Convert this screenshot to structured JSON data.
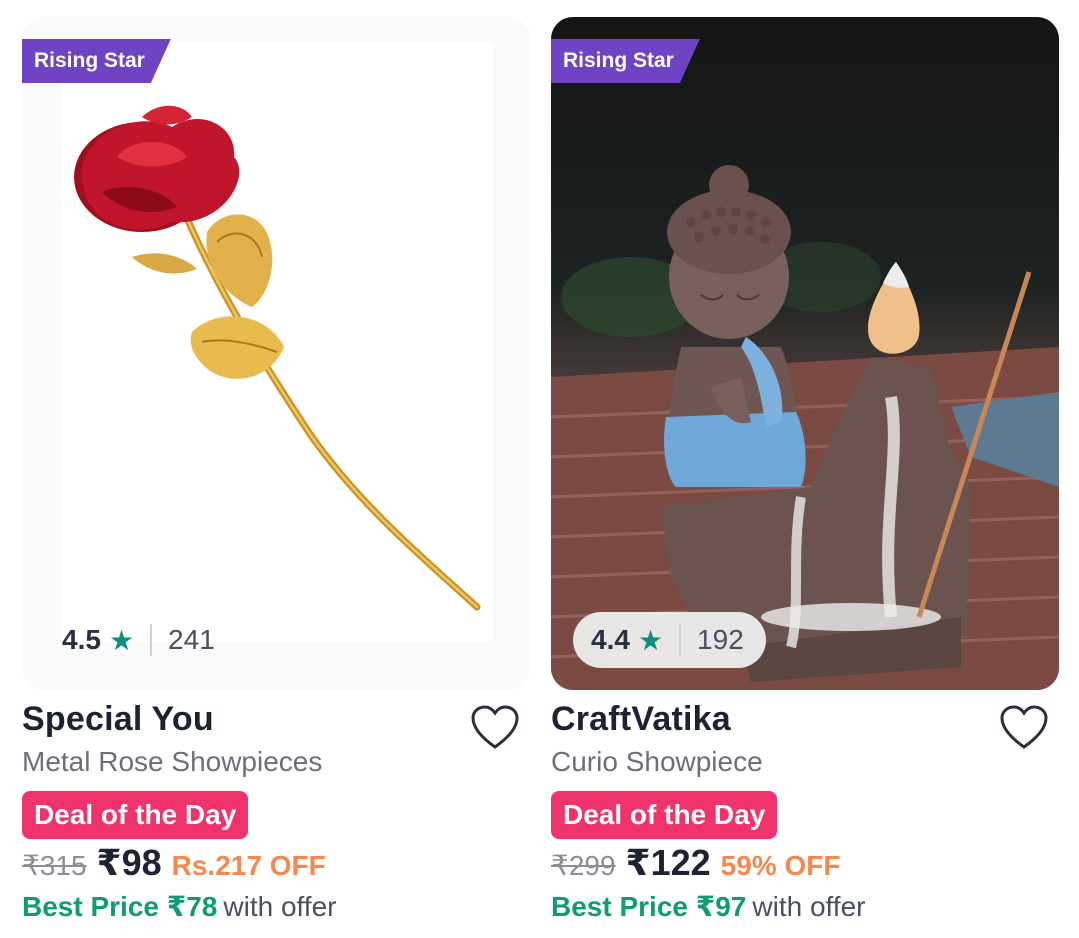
{
  "products": [
    {
      "tag": "Rising Star",
      "rating": "4.5",
      "rating_star": "★",
      "rating_count": "241",
      "brand": "Special You",
      "name": "Metal Rose Showpieces",
      "deal": "Deal of the Day",
      "mrp": "₹315",
      "price": "₹98",
      "off": "Rs.217 OFF",
      "best_price": "Best Price ₹78",
      "best_suffix": "with offer",
      "image_icon": "golden-rose-image"
    },
    {
      "tag": "Rising Star",
      "rating": "4.4",
      "rating_star": "★",
      "rating_count": "192",
      "brand": "CraftVatika",
      "name": "Curio Showpiece",
      "deal": "Deal of the Day",
      "mrp": "₹299",
      "price": "₹122",
      "off": "59% OFF",
      "best_price": "Best Price ₹97",
      "best_suffix": "with offer",
      "image_icon": "buddha-incense-burner-image"
    }
  ],
  "colors": {
    "tag_bg": "#6e43c4",
    "deal_bg": "#f0336a",
    "best_price": "#0f9b76",
    "off": "#f5894d",
    "star": "#0f8f7e"
  }
}
